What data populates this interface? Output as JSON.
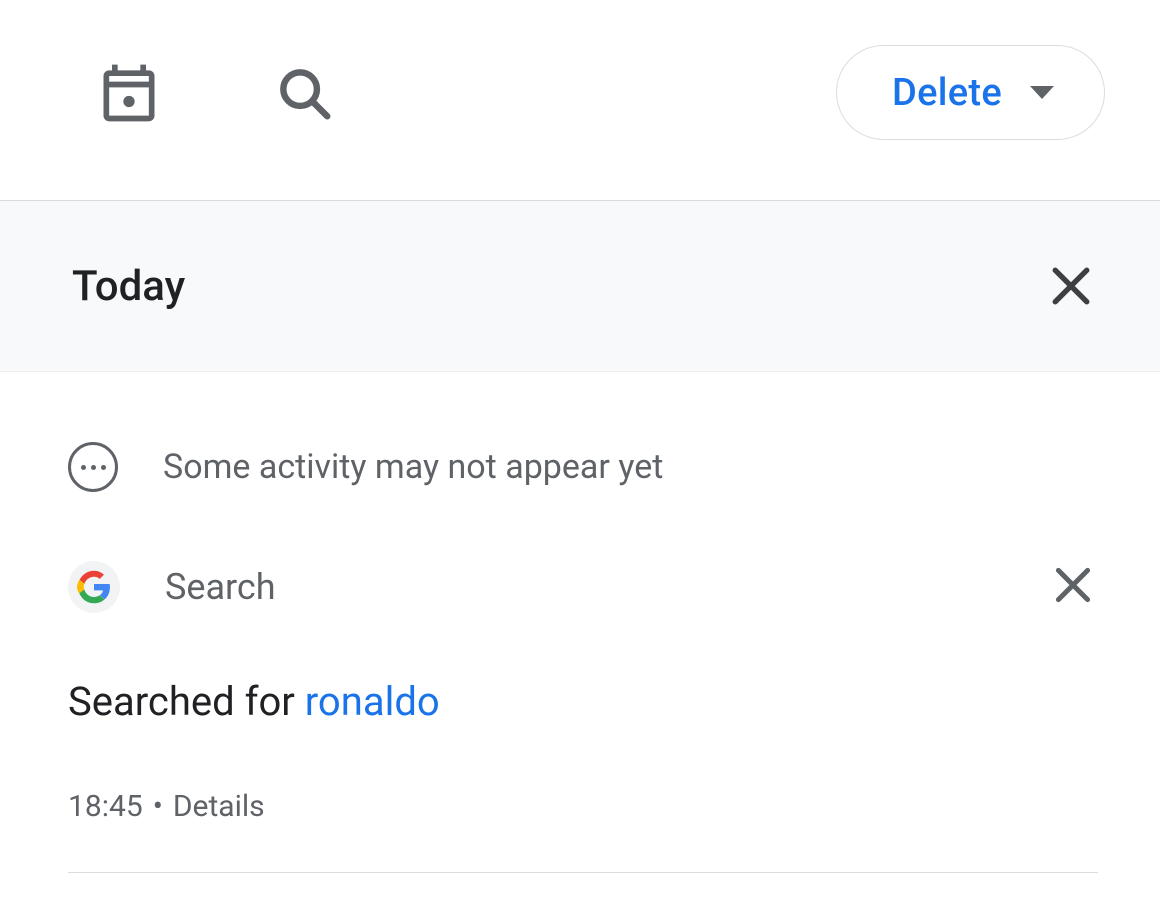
{
  "toolbar": {
    "delete_label": "Delete"
  },
  "section": {
    "heading": "Today"
  },
  "notice": {
    "text": "Some activity may not appear yet"
  },
  "activity": {
    "product": "Search",
    "action_prefix": "Searched for ",
    "query": "ronaldo",
    "time": "18:45",
    "details_label": "Details"
  }
}
